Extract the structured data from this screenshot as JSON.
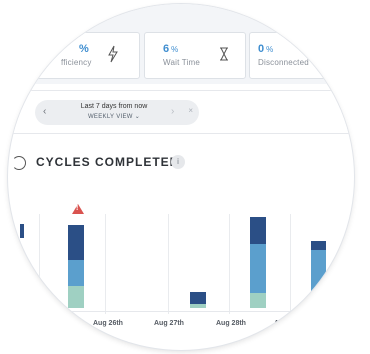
{
  "metrics": [
    {
      "value": "%",
      "label": "fficiency",
      "icon": "lightning-icon"
    },
    {
      "value": "6",
      "unit": "%",
      "label": "Wait Time",
      "icon": "hourglass-icon"
    },
    {
      "value": "0",
      "unit": "%",
      "label": "Disconnected"
    }
  ],
  "filter": {
    "range": "Last 7 days from now",
    "view": "WEEKLY VIEW",
    "clear": "×"
  },
  "section": {
    "title": "CYCLES COMPLETED",
    "info": "i"
  },
  "chart_data": {
    "type": "bar",
    "stacked": true,
    "categories": [
      "Aug 26th",
      "Aug 27th",
      "Aug 28th",
      "Aug"
    ],
    "colors": [
      "#9fd0c2",
      "#5b9fcd",
      "#2b4f86"
    ]
  }
}
